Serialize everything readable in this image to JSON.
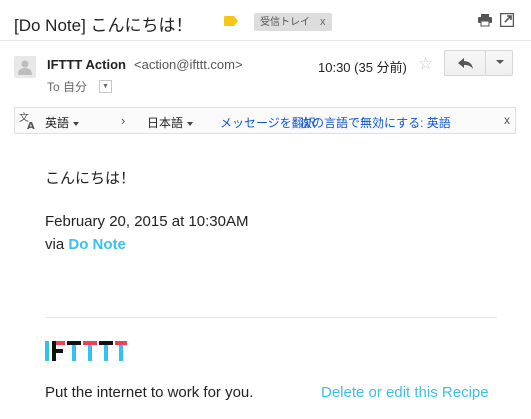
{
  "subject": {
    "title": "[Do Note] こんにちは！",
    "label_icon": "label-tag-icon",
    "label_color": "#f5c518",
    "inbox_label": "受信トレイ",
    "inbox_remove": "x",
    "actions": [
      "print-icon",
      "new-window-icon"
    ]
  },
  "message_header": {
    "sender_name": "IFTTT Action",
    "sender_email": "<action@ifttt.com>",
    "recipient": "To 自分",
    "timestamp": "10:30 (35 分前)",
    "star_icon": "star-icon",
    "reply_icon": "reply-icon",
    "more_icon": "chevron-down-icon"
  },
  "translate_bar": {
    "source_language": "英語",
    "target_language": "日本語",
    "translate_link": "メッセージを翻訳",
    "disable_link": "次の言語で無効にする: 英語",
    "close": "x"
  },
  "body": {
    "greeting": "こんにちは！",
    "date_line": "February 20, 2015 at 10:30AM",
    "via_prefix": "via",
    "via_link": "Do Note",
    "link_color": "#3cbfe8",
    "tagline": "Put the internet to work for you.",
    "recipe_link": "Delete or edit this Recipe",
    "logo": "IFTTT"
  }
}
